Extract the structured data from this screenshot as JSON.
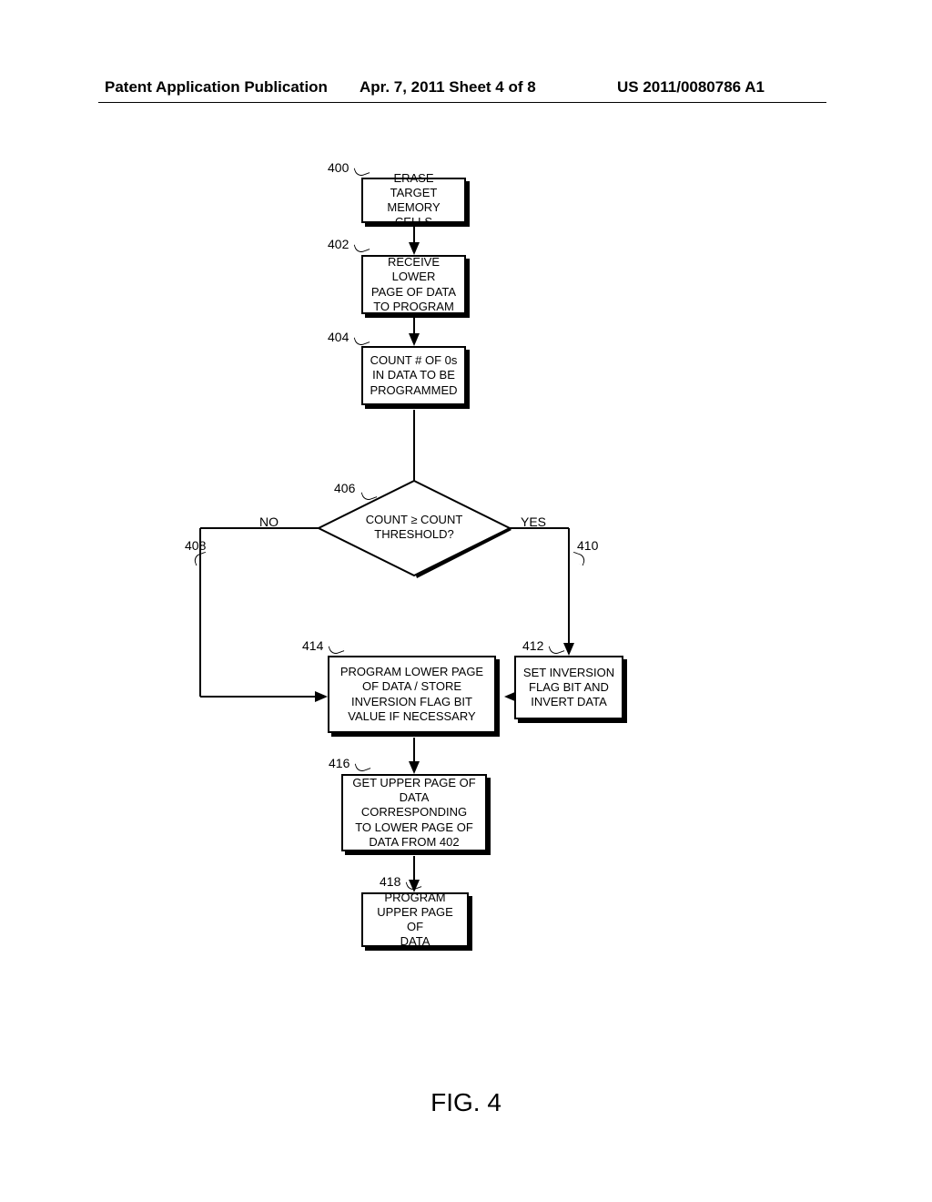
{
  "header": {
    "left": "Patent Application Publication",
    "center": "Apr. 7, 2011  Sheet 4 of 8",
    "right": "US 2011/0080786 A1"
  },
  "labels": {
    "l400": "400",
    "l402": "402",
    "l404": "404",
    "l406": "406",
    "l408": "408",
    "l410": "410",
    "l412": "412",
    "l414": "414",
    "l416": "416",
    "l418": "418",
    "no": "NO",
    "yes": "YES"
  },
  "boxes": {
    "b400": "ERASE TARGET\nMEMORY CELLS",
    "b402": "RECEIVE LOWER\nPAGE OF DATA\nTO PROGRAM",
    "b404": "COUNT # OF 0s\nIN DATA TO BE\nPROGRAMMED",
    "b406": "COUNT ≥ COUNT\nTHRESHOLD?",
    "b412": "SET INVERSION\nFLAG BIT AND\nINVERT DATA",
    "b414": "PROGRAM LOWER PAGE\nOF DATA / STORE\nINVERSION FLAG BIT\nVALUE IF NECESSARY",
    "b416": "GET UPPER PAGE OF\nDATA CORRESPONDING\nTO LOWER PAGE OF\nDATA FROM 402",
    "b418": "PROGRAM\nUPPER PAGE OF\nDATA"
  },
  "figure": "FIG. 4"
}
